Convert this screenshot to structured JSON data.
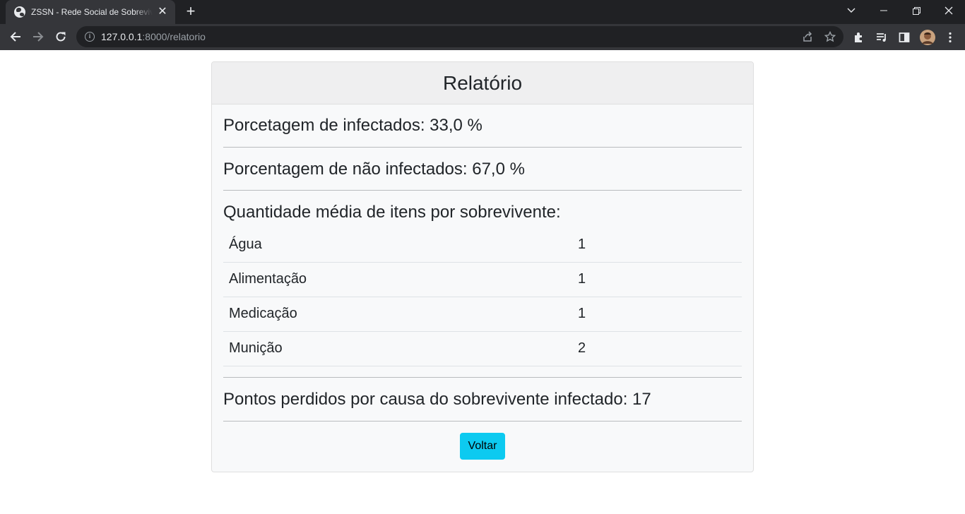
{
  "browser": {
    "tab_title": "ZSSN - Rede Social de Sobreviventes",
    "tab_close": "✕",
    "new_tab": "+",
    "url_host": "127.0.0.1",
    "url_rest": ":8000/relatorio"
  },
  "report": {
    "title": "Relatório",
    "infected_pct": "Porcetagem de infectados: 33,0 %",
    "not_infected_pct": "Porcentagem de não infectados: 67,0 %",
    "items_heading": "Quantidade média de itens por sobrevivente:",
    "items": [
      {
        "name": "Água",
        "qty": "1"
      },
      {
        "name": "Alimentação",
        "qty": "1"
      },
      {
        "name": "Medicação",
        "qty": "1"
      },
      {
        "name": "Munição",
        "qty": "2"
      }
    ],
    "points_lost": "Pontos perdidos por causa do sobrevivente infectado: 17",
    "back_button": "Voltar"
  },
  "colors": {
    "chrome_dark": "#202124",
    "chrome_tab": "#35363a",
    "button_info": "#0dcaf0",
    "text": "#212529"
  }
}
